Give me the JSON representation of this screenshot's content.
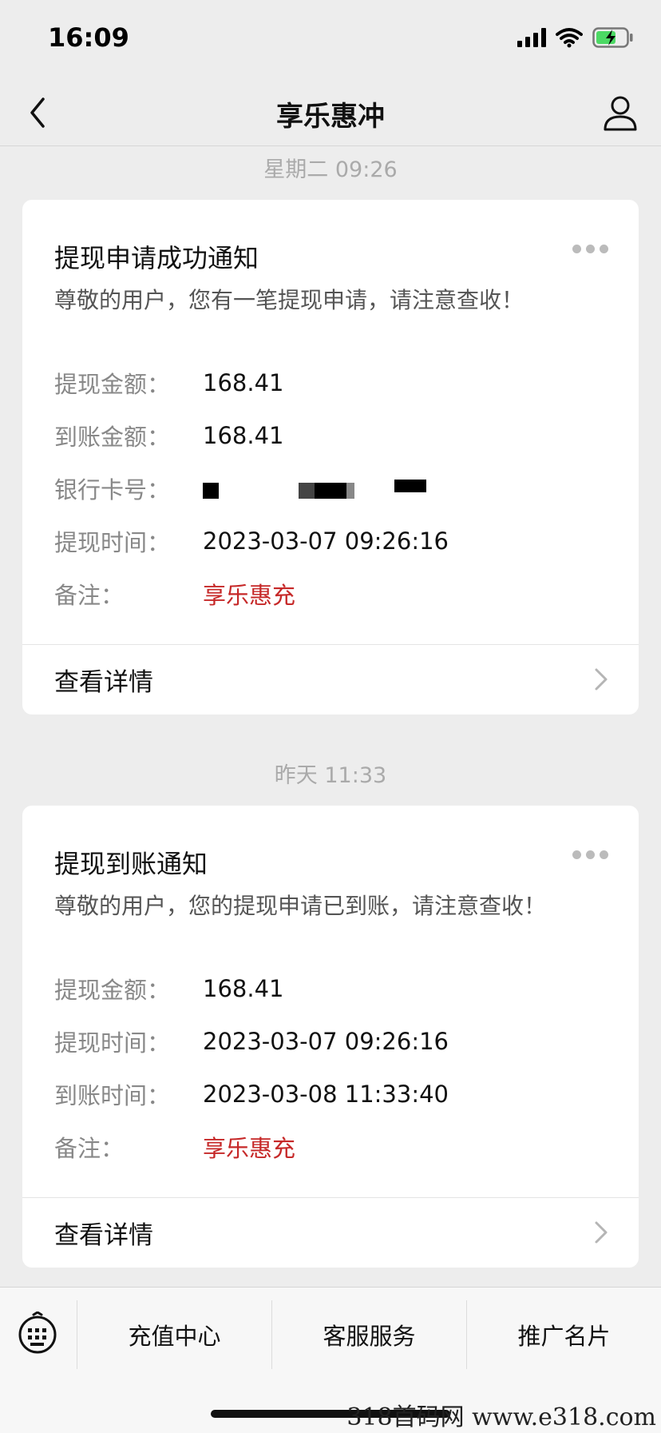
{
  "status_bar": {
    "time": "16:09"
  },
  "nav": {
    "title": "享乐惠冲"
  },
  "messages": [
    {
      "timestamp": "星期二 09:26",
      "title": "提现申请成功通知",
      "subtitle": "尊敬的用户，您有一笔提现申请，请注意查收！",
      "rows": [
        {
          "label": "提现金额：",
          "value": "168.41"
        },
        {
          "label": "到账金额：",
          "value": "168.41"
        },
        {
          "label": "银行卡号：",
          "value": ""
        },
        {
          "label": "提现时间：",
          "value": "2023-03-07 09:26:16"
        },
        {
          "label": "备注：",
          "value": "享乐惠充"
        }
      ],
      "link": "查看详情"
    },
    {
      "timestamp": "昨天 11:33",
      "title": "提现到账通知",
      "subtitle": "尊敬的用户，您的提现申请已到账，请注意查收！",
      "rows": [
        {
          "label": "提现金额：",
          "value": "168.41"
        },
        {
          "label": "提现时间：",
          "value": "2023-03-07 09:26:16"
        },
        {
          "label": "到账时间：",
          "value": "2023-03-08 11:33:40"
        },
        {
          "label": "备注：",
          "value": "享乐惠充"
        }
      ],
      "link": "查看详情"
    }
  ],
  "menu": {
    "items": [
      "充值中心",
      "客服服务",
      "推广名片"
    ]
  },
  "watermark": "318首码网  www.e318.com",
  "icons": {
    "back": "chevron-left-icon",
    "profile": "person-icon",
    "more": "more-dots-icon",
    "arrow": "chevron-right-icon",
    "keyboard": "keyboard-icon"
  },
  "colors": {
    "accent": "#c62828",
    "background": "#ededed"
  }
}
